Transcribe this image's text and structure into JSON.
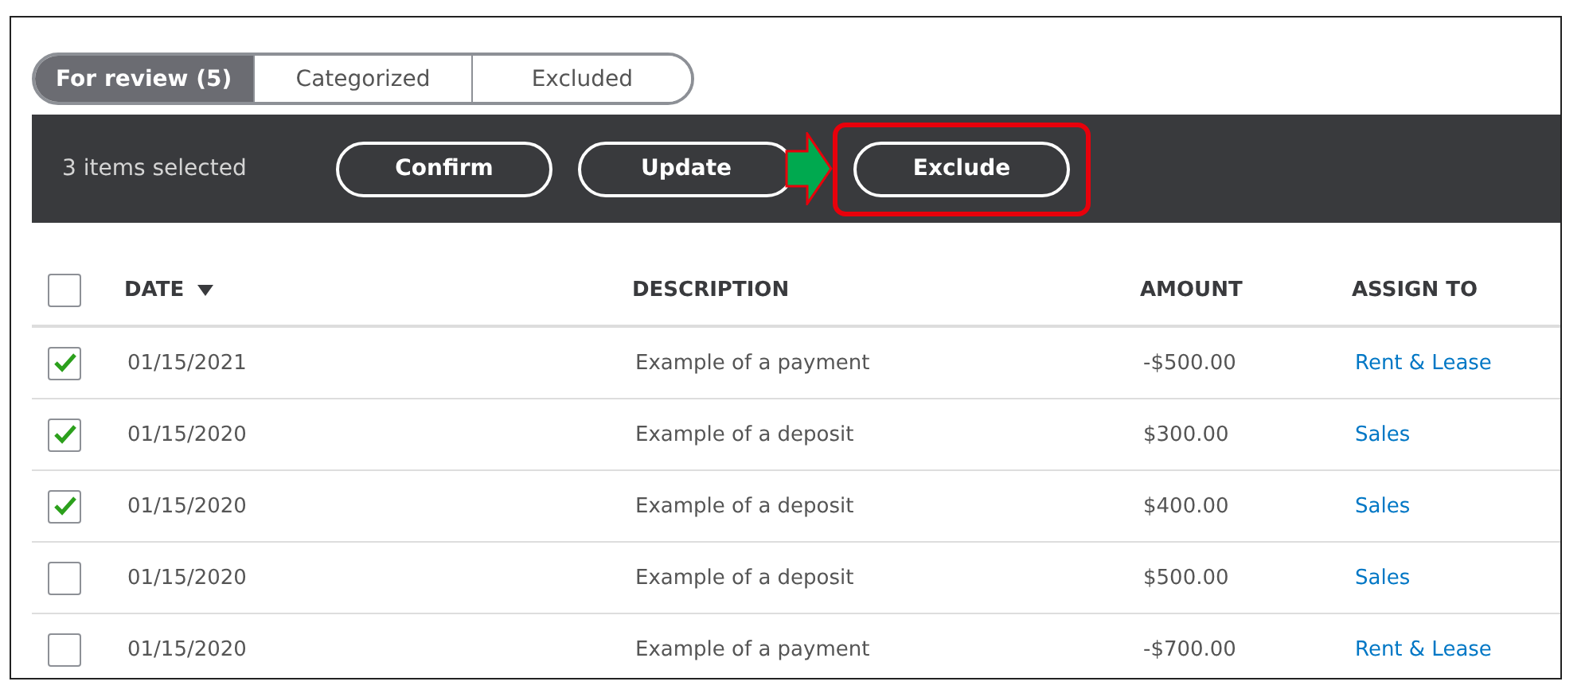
{
  "tabs": [
    {
      "label": "For review (5)",
      "selected": true
    },
    {
      "label": "Categorized",
      "selected": false
    },
    {
      "label": "Excluded",
      "selected": false
    }
  ],
  "action_bar": {
    "selection_count": "3 items selected",
    "buttons": [
      {
        "label": "Confirm",
        "highlighted": false
      },
      {
        "label": "Update",
        "highlighted": false
      },
      {
        "label": "Exclude",
        "highlighted": true
      }
    ]
  },
  "table": {
    "select_all": {
      "checked": false
    },
    "columns": [
      {
        "label": "DATE",
        "sorted": true
      },
      {
        "label": "DESCRIPTION",
        "sorted": false
      },
      {
        "label": "AMOUNT",
        "sorted": false
      },
      {
        "label": "ASSIGN TO",
        "sorted": false
      }
    ],
    "rows": [
      {
        "checked": true,
        "date": "01/15/2021",
        "description": "Example of a payment",
        "amount": "-$500.00",
        "assign_to": "Rent & Lease"
      },
      {
        "checked": true,
        "date": "01/15/2020",
        "description": "Example of a deposit",
        "amount": "$300.00",
        "assign_to": "Sales"
      },
      {
        "checked": true,
        "date": "01/15/2020",
        "description": "Example of a deposit",
        "amount": "$400.00",
        "assign_to": "Sales"
      },
      {
        "checked": false,
        "date": "01/15/2020",
        "description": "Example of a deposit",
        "amount": "$500.00",
        "assign_to": "Sales"
      },
      {
        "checked": false,
        "date": "01/15/2020",
        "description": "Example of a payment",
        "amount": "-$700.00",
        "assign_to": "Rent & Lease"
      }
    ]
  }
}
